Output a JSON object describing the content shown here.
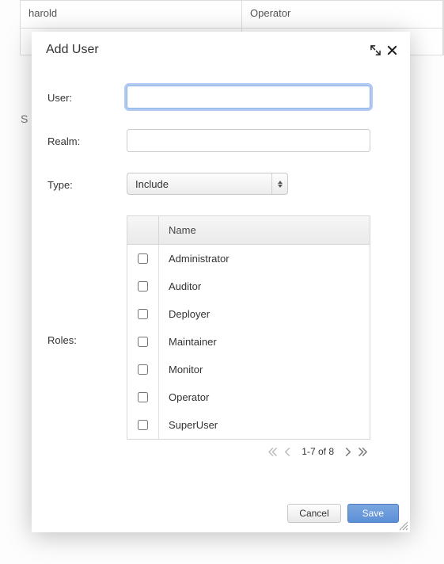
{
  "background": {
    "rows": [
      {
        "user": "harold",
        "role": "Operator"
      },
      {
        "user": "",
        "role": ""
      }
    ],
    "sidebar_letter": "S"
  },
  "modal": {
    "title": "Add User",
    "labels": {
      "user": "User:",
      "realm": "Realm:",
      "type": "Type:",
      "roles": "Roles:"
    },
    "user_value": "",
    "realm_value": "",
    "type_selected": "Include",
    "roles_header": "Name",
    "roles": [
      {
        "name": "Administrator",
        "checked": false
      },
      {
        "name": "Auditor",
        "checked": false
      },
      {
        "name": "Deployer",
        "checked": false
      },
      {
        "name": "Maintainer",
        "checked": false
      },
      {
        "name": "Monitor",
        "checked": false
      },
      {
        "name": "Operator",
        "checked": false
      },
      {
        "name": "SuperUser",
        "checked": false
      }
    ],
    "pager_text": "1-7 of 8",
    "buttons": {
      "cancel": "Cancel",
      "save": "Save"
    }
  }
}
